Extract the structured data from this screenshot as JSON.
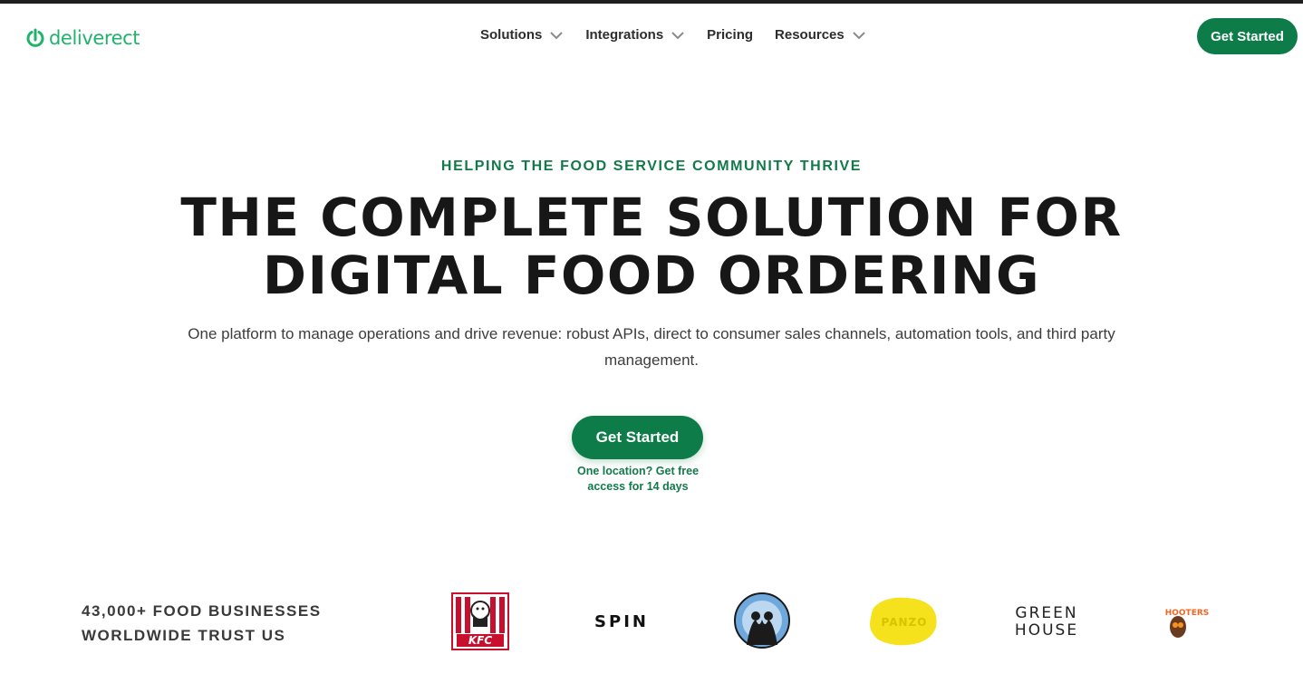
{
  "header": {
    "logo_text": "deliverect",
    "nav": [
      {
        "label": "Solutions",
        "has_dropdown": true
      },
      {
        "label": "Integrations",
        "has_dropdown": true
      },
      {
        "label": "Pricing",
        "has_dropdown": false
      },
      {
        "label": "Resources",
        "has_dropdown": true
      }
    ],
    "cta_label": "Get Started"
  },
  "hero": {
    "eyebrow": "HELPING THE FOOD SERVICE COMMUNITY THRIVE",
    "headline_line1": "THE COMPLETE SOLUTION FOR",
    "headline_line2": "DIGITAL FOOD ORDERING",
    "subtitle": "One platform to manage operations and drive revenue: robust APIs, direct to consumer sales channels, automation tools, and third party management.",
    "cta_label": "Get Started",
    "note_line1": "One location? Get free",
    "note_line2": "access for 14 days"
  },
  "trust": {
    "line1": "43,000+ FOOD BUSINESSES",
    "line2": "WORLDWIDE TRUST US",
    "logos": {
      "kfc": "KFC",
      "spin": "SPIN",
      "greenhouse_line1": "GREEN",
      "greenhouse_line2": "HOUSE",
      "panzo": "PANZO",
      "hooters": "HOOTERS"
    }
  },
  "colors": {
    "brand_green": "#0e7c49",
    "logo_green": "#1fb36b",
    "eyebrow_green": "#127a4a",
    "headline": "#171717"
  },
  "icons": {
    "logo_mark": "deliverect-power-icon",
    "dropdown": "chevron-down-icon"
  }
}
